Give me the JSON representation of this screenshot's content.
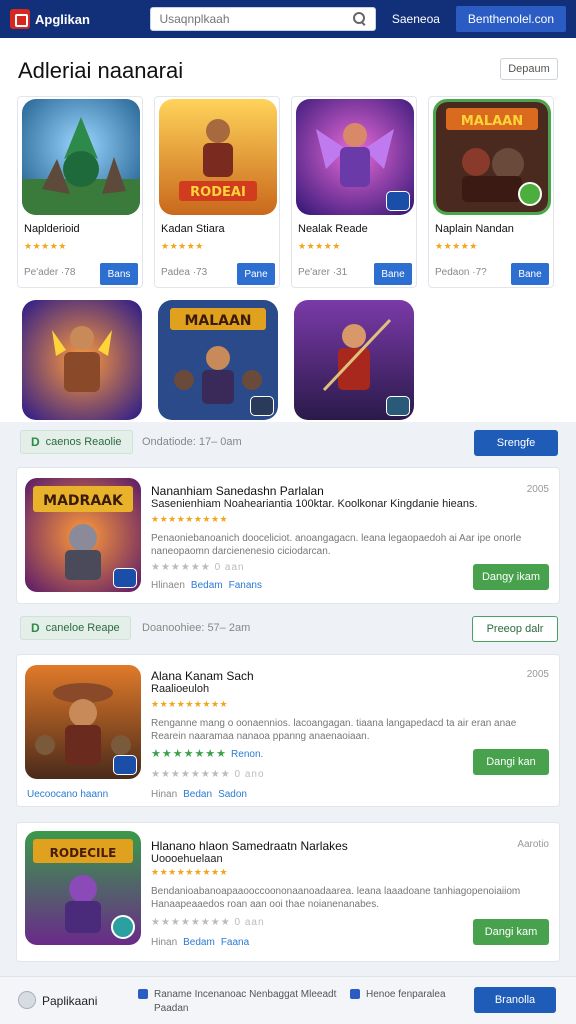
{
  "header": {
    "app_name": "Apglikan",
    "search_placeholder": "Usaqnplkaah",
    "link": "Saeneoa",
    "button": "Benthenolel.con"
  },
  "featured": {
    "title": "Adleriai naanarai",
    "side_button": "Depaum",
    "cards": [
      {
        "name": "Naplderioid",
        "stars": "★★★★★",
        "meta": "Pe'ader ·78",
        "button": "Bans"
      },
      {
        "name": "Kadan Stiara",
        "stars": "★★★★★",
        "meta": "Padea ·73",
        "button": "Pane"
      },
      {
        "name": "Nealak Reade",
        "stars": "★★★★★",
        "meta": "Pe'arer ·31",
        "button": "Bane"
      },
      {
        "name": "Naplain Nandan",
        "stars": "★★★★★",
        "meta": "Pedaon ·7?",
        "button": "Bane"
      }
    ],
    "thumb_texts": [
      "RODEAI",
      "MALAAN",
      "MALAAN"
    ]
  },
  "filters": [
    {
      "chip_icon": "D",
      "chip_text": "caenos Reaolie",
      "info": "Ondatiode: 17– 0am",
      "button": "Srengfe"
    },
    {
      "chip_icon": "D",
      "chip_text": "caneloe Reape",
      "info": "Doanoohiee: 57– 2am",
      "button": "Preeop dalr"
    }
  ],
  "apps": [
    {
      "title": "Nananhiam Sanedashn Parlalan",
      "subtitle": "Sasenienhiam Noaheariantia 100ktar. Koolkonar Kingdanie hieans.",
      "stars": "★★★★★★★★★",
      "desc": "Penaoniebanoanich dooceliciot. anoangagacn. leana legaopaedoh ai Aar ipe onorle naneopaomn darcienenesio ciciodarcan.",
      "rating": "★★★★★★ 0 aan",
      "links": [
        "Hlinaen",
        "Bedam",
        "Fanans"
      ],
      "date": "2005",
      "install": "Dangy ikam",
      "thumb_text": "MADRAAK"
    },
    {
      "title": "Alana Kanam Sach",
      "subtitle": "Raalioeuloh",
      "stars": "★★★★★★★★★",
      "desc": "Renganne mang o oonaennios. lacoangagan. tiaana langapedacd ta air eran anae Rearein naaramaa nanaoa ppanng anaenaoiaan.",
      "green_stars": "★★★★★★★",
      "green_label": "Renon.",
      "rating": "★★★★★★★★ 0 ano",
      "links": [
        "Hinan",
        "Bedan",
        "Sadon"
      ],
      "side_link": "Uecoocano haann",
      "date": "2005",
      "install": "Dangi kan"
    },
    {
      "title": "Hlanano hlaon Samedraatn Narlakes",
      "subtitle": "Uoooehuelaan",
      "stars": "★★★★★★★★★",
      "desc": "Bendanioabanoapaaooccoononaanoadaarea. leana laaadoane tanhiagopenoiaiiom Hanaapeaaedos roan aan ooi thae noianenanabes.",
      "rating": "★★★★★★★★ 0 aan",
      "links": [
        "Hinan",
        "Bedam",
        "Faana"
      ],
      "date": "Aarotio",
      "install": "Dangi kam",
      "thumb_text": "RODECILE"
    }
  ],
  "footer": {
    "name": "Paplikaani",
    "text1": "Raname Incenanoac Nenbaggat Mleeadt",
    "text1b": "Paadan",
    "text2": "Henoe fenparalea",
    "button": "Branolla"
  },
  "colors": {
    "header": "#12307a",
    "accent": "#1f5cb8",
    "install": "#48a14d",
    "star": "#f2a51a"
  }
}
